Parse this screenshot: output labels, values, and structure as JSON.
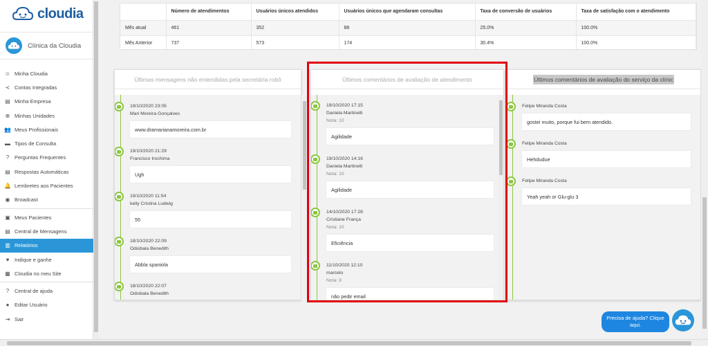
{
  "app": {
    "logo": "cloudia",
    "clinic": "Clínica da Cloudia"
  },
  "menu": [
    {
      "label": "Minha Cloudia",
      "icon": "face-icon"
    },
    {
      "label": "Contas Integradas",
      "icon": "share-icon"
    },
    {
      "label": "Minha Empresa",
      "icon": "store-icon"
    },
    {
      "label": "Minhas Unidades",
      "icon": "add-circle-icon"
    },
    {
      "label": "Meus Profissionais",
      "icon": "people-icon"
    },
    {
      "label": "Tipos de Consulta",
      "icon": "list-icon"
    },
    {
      "label": "Perguntas Frequentes",
      "icon": "help-box-icon"
    },
    {
      "label": "Respostas Automáticas",
      "icon": "message-box-icon"
    },
    {
      "label": "Lembretes aos Pacientes",
      "icon": "bell-icon"
    },
    {
      "label": "Broadcast",
      "icon": "broadcast-icon"
    },
    {
      "label": "Meus Pacientes",
      "icon": "contact-icon"
    },
    {
      "label": "Central de Mensagens",
      "icon": "chat-icon"
    },
    {
      "label": "Relatórios",
      "icon": "chart-icon",
      "active": true
    },
    {
      "label": "Indique e ganhe",
      "icon": "heart-icon"
    },
    {
      "label": "Cloudia no meu Site",
      "icon": "widgets-icon"
    },
    {
      "label": "Central de ajuda",
      "icon": "help-circle-icon"
    },
    {
      "label": "Editar Usuário",
      "icon": "person-icon"
    },
    {
      "label": "Sair",
      "icon": "logout-icon"
    }
  ],
  "stats": {
    "headers": [
      "",
      "Número de atendimentos",
      "Usuários únicos atendidos",
      "Usuários únicos que agendaram consultas",
      "Taxa de conversão de usuários",
      "Taxa de satisfação com o atendimento"
    ],
    "rows": [
      [
        "Mês atual",
        "461",
        "352",
        "88",
        "25.0%",
        "100.0%"
      ],
      [
        "Mês Anterior",
        "737",
        "573",
        "174",
        "30.4%",
        "100.0%"
      ]
    ]
  },
  "panels": {
    "unrecognized": {
      "title": "Últimas mensagens não entendidas pela secretária robô",
      "items": [
        {
          "date": "19/10/2020 23:05",
          "name": "Mari Moreira Gonçalves",
          "text": "www.dramarianamoreira.com.br"
        },
        {
          "date": "19/10/2020 21:29",
          "name": "Francisco Irochima",
          "text": "Ugh"
        },
        {
          "date": "19/10/2020 11:54",
          "name": "kelly Cristina Ludwig",
          "text": "55"
        },
        {
          "date": "18/10/2020 22:09",
          "name": "Odiobala Benedith",
          "text": "Abbla spaniola"
        },
        {
          "date": "18/10/2020 22:07",
          "name": "Odiobala Benedith",
          "text": ""
        }
      ]
    },
    "attendance": {
      "title": "Últimos comentários de avaliação de atendimento",
      "items": [
        {
          "date": "19/10/2020 17:15",
          "name": "Daniela Martinelli",
          "nota": "Nota: 10",
          "text": "Agilidade"
        },
        {
          "date": "19/10/2020 14:16",
          "name": "Daniela Martinelli",
          "nota": "Nota: 10",
          "text": "Agilidade"
        },
        {
          "date": "14/10/2020 17:28",
          "name": "Cristiane França",
          "nota": "Nota: 10",
          "text": "Eficiência"
        },
        {
          "date": "11/10/2020 12:10",
          "name": "marcelo",
          "nota": "Nota: 9",
          "text": "não pedir email"
        }
      ]
    },
    "service": {
      "title": "Últimos comentários de avaliação do serviço da clínic",
      "items": [
        {
          "name": "Felipe Miranda Costa",
          "text": "gostei muito, porque fui bem atendido."
        },
        {
          "name": "Felipe Miranda Costa",
          "text": "Hehdudue"
        },
        {
          "name": "Felipe Miranda Costa",
          "text": "Yeah yeah or Glu-glu 3"
        }
      ]
    }
  },
  "help": {
    "text": "Precisa de ajuda? Clique aqui."
  },
  "colors": {
    "accent": "#2a96d8",
    "timeline": "#8cc63f",
    "highlight": "#e1000f"
  }
}
